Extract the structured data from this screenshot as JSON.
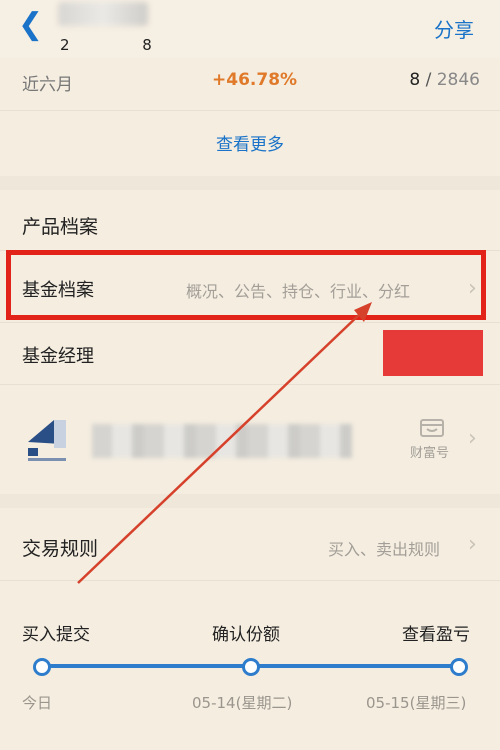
{
  "header": {
    "back_icon": "chevron-left-icon",
    "fund_code": "2 8",
    "share_label": "分享"
  },
  "performance": {
    "period_label": "近六月",
    "return_value": "+46.78%",
    "rank": "8",
    "rank_total": "2846",
    "rank_separator": " / "
  },
  "more_link": "查看更多",
  "product": {
    "section_title": "产品档案",
    "fund_profile_label": "基金档案",
    "fund_profile_sub": "概况、公告、持仓、行业、分红",
    "fund_manager_label": "基金经理",
    "company_caption": "财富号"
  },
  "trade": {
    "rules_label": "交易规则",
    "rules_sub": "买入、卖出规则"
  },
  "timeline": {
    "steps": [
      "买入提交",
      "确认份额",
      "查看盈亏"
    ],
    "dates": [
      "今日",
      "05-14(星期二)",
      "05-15(星期三)"
    ]
  },
  "colors": {
    "accent": "#1a73c8",
    "positive": "#e07a2a",
    "highlight": "#e2231a"
  }
}
